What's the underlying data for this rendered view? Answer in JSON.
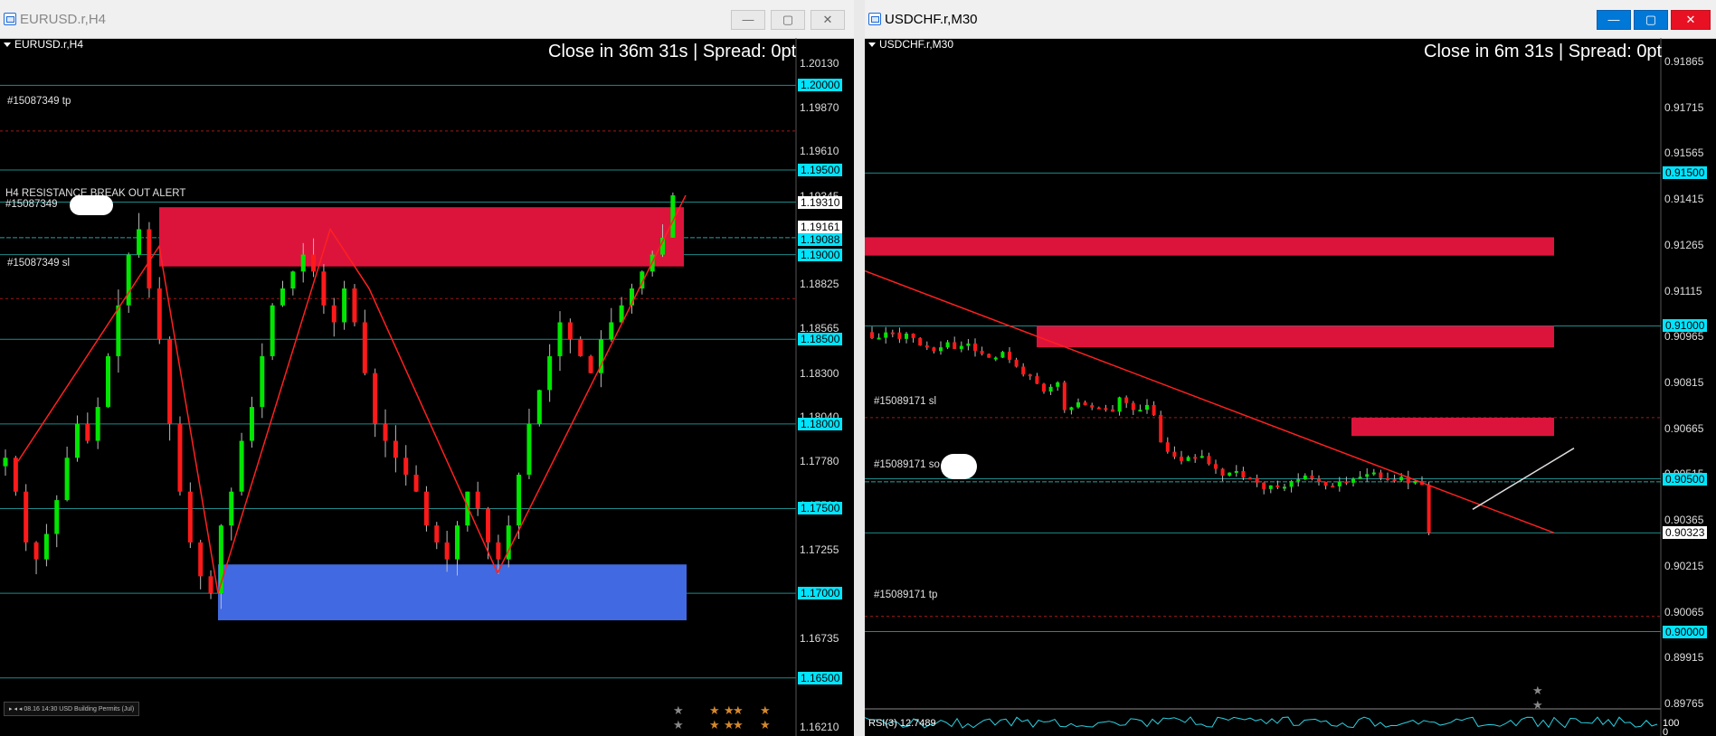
{
  "windows": [
    {
      "title": "EURUSD.r,H4",
      "symbol_header": "EURUSD.r,H4",
      "countdown": "Close in 36m 31s | Spread: 0pt",
      "annotations": {
        "tp": "#15087349 tp",
        "sl": "#15087349 sl",
        "alert": "H4 RESISTANCE BREAK OUT ALERT",
        "alert_sub": "#15087349"
      },
      "news": "▸ ◂ ◂  08.16 14:30 USD Building Permits (Jul)",
      "y_axis": [
        "1.20130",
        "1.19870",
        "1.19610",
        "1.19345",
        "1.18825",
        "1.18565",
        "1.18300",
        "1.18040",
        "1.17780",
        "1.17520",
        "1.17255",
        "1.16735",
        "1.16210"
      ],
      "price_tags": [
        {
          "value": "1.20000",
          "style": "cyan"
        },
        {
          "value": "1.19500",
          "style": "cyan"
        },
        {
          "value": "1.19310",
          "style": "white"
        },
        {
          "value": "1.19161",
          "style": "white"
        },
        {
          "value": "1.19088",
          "style": "cyan"
        },
        {
          "value": "1.19000",
          "style": "cyan"
        },
        {
          "value": "1.18500",
          "style": "cyan"
        },
        {
          "value": "1.18000",
          "style": "cyan"
        },
        {
          "value": "1.17500",
          "style": "cyan"
        },
        {
          "value": "1.17000",
          "style": "cyan"
        },
        {
          "value": "1.16500",
          "style": "cyan"
        }
      ],
      "buttons": {
        "minimize": "—",
        "maximize": "▢",
        "close": "✕"
      }
    },
    {
      "title": "USDCHF.r,M30",
      "symbol_header": "USDCHF.r,M30",
      "countdown": "Close in 6m 31s | Spread: 0pt",
      "annotations": {
        "sl": "#15089171 sl",
        "so": "#15089171 so",
        "tp": "#15089171 tp"
      },
      "rsi": "RSI(3) 12.7489",
      "rsi_scale": "100",
      "rsi_zero": "0",
      "y_axis": [
        "0.91865",
        "0.91715",
        "0.91565",
        "0.91415",
        "0.91265",
        "0.91115",
        "0.90965",
        "0.90815",
        "0.90665",
        "0.90515",
        "0.90365",
        "0.90215",
        "0.90065",
        "0.89915",
        "0.89765"
      ],
      "price_tags": [
        {
          "value": "0.91500",
          "style": "cyan"
        },
        {
          "value": "0.91000",
          "style": "cyan"
        },
        {
          "value": "0.90500",
          "style": "cyan"
        },
        {
          "value": "0.90323",
          "style": "white"
        },
        {
          "value": "0.90000",
          "style": "cyan"
        }
      ],
      "buttons": {
        "minimize": "—",
        "maximize": "▢",
        "close": "✕"
      }
    }
  ],
  "colors": {
    "bull": "#00e600",
    "bear": "#ff1a1a",
    "zone_red": "#dc143c",
    "zone_blue": "#4169e1",
    "level": "#1e8a8a",
    "tag_cyan": "#00e5ff"
  }
}
